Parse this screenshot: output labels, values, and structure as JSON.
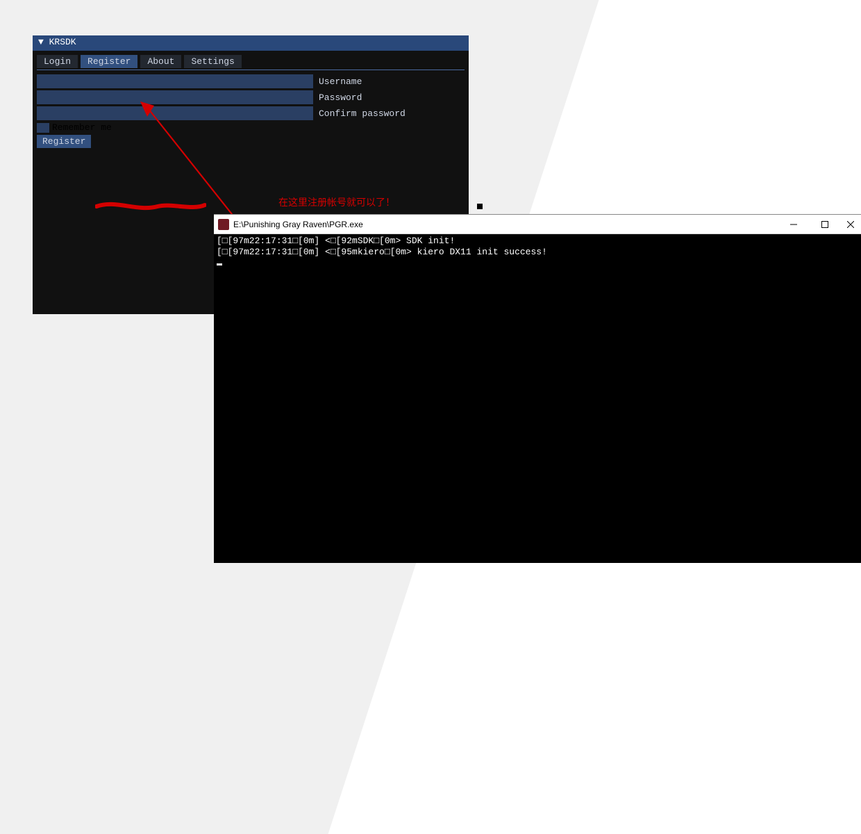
{
  "panel": {
    "title": "▼ KRSDK",
    "tabs": {
      "login": "Login",
      "register": "Register",
      "about": "About",
      "settings": "Settings"
    },
    "labels": {
      "username": "Username",
      "password": "Password",
      "confirm": "Confirm password",
      "remember": "Remember me"
    },
    "register_button": "Register"
  },
  "annotation": {
    "text": "在这里注册帐号就可以了！"
  },
  "console": {
    "title": "E:\\Punishing Gray Raven\\PGR.exe",
    "lines": [
      "[□[97m22:17:31□[0m] <□[92mSDK□[0m> SDK init!",
      "[□[97m22:17:31□[0m] <□[95mkiero□[0m> kiero DX11 init success!"
    ]
  }
}
